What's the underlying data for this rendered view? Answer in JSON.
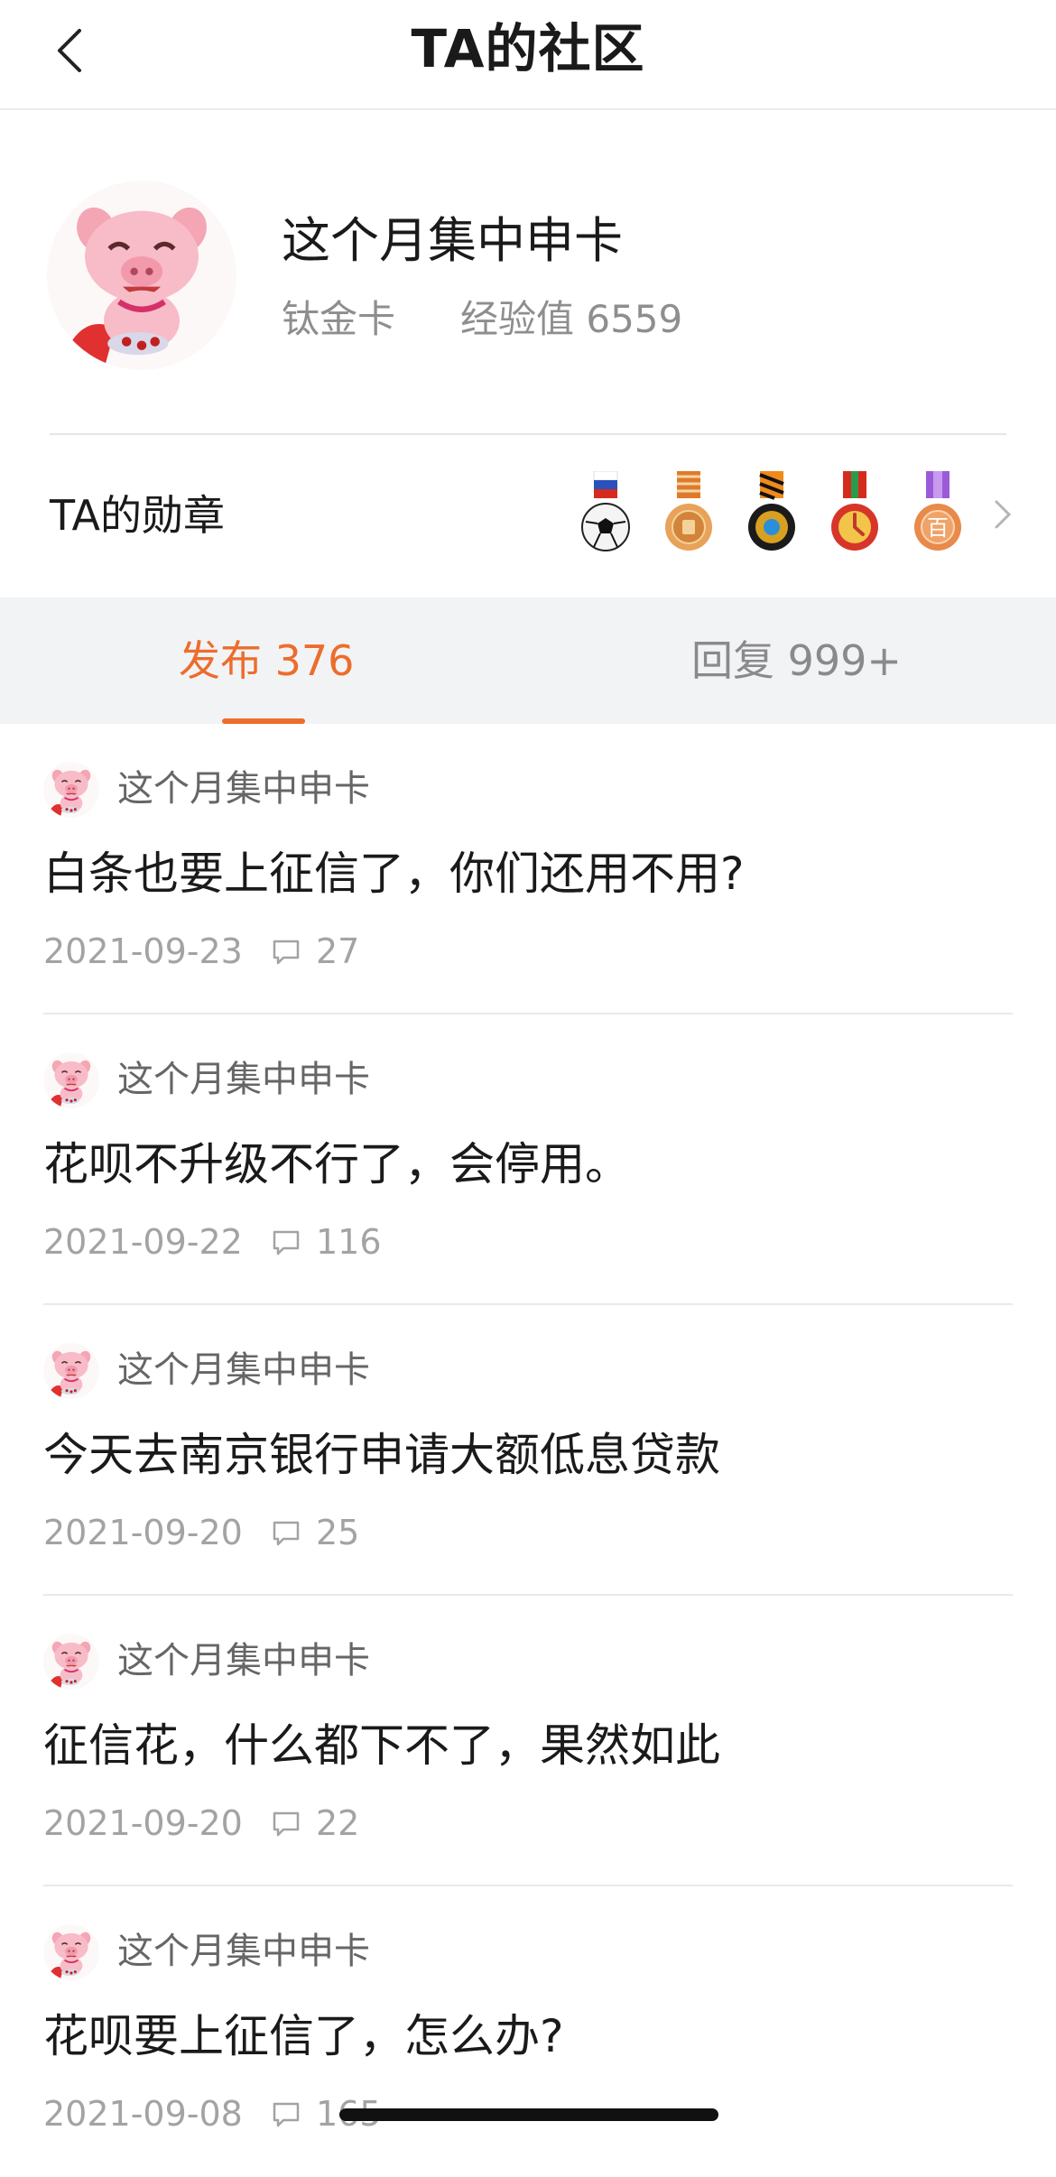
{
  "nav": {
    "title": "TA的社区"
  },
  "profile": {
    "name": "这个月集中申卡",
    "level": "钛金卡",
    "exp_label": "经验值 6559"
  },
  "badges": {
    "label": "TA的勋章",
    "items": [
      "football-medal-icon",
      "orange-ribbon-medal-icon",
      "striped-ribbon-medal-icon",
      "red-green-medal-icon",
      "bai-medal-icon"
    ],
    "bai_char": "百"
  },
  "tabs": [
    {
      "label": "发布 376",
      "active": true
    },
    {
      "label": "回复 999+",
      "active": false
    }
  ],
  "posts": [
    {
      "author": "这个月集中申卡",
      "title": "白条也要上征信了，你们还用不用?",
      "date": "2021-09-23",
      "comments": "27"
    },
    {
      "author": "这个月集中申卡",
      "title": "花呗不升级不行了，会停用。",
      "date": "2021-09-22",
      "comments": "116"
    },
    {
      "author": "这个月集中申卡",
      "title": "今天去南京银行申请大额低息贷款",
      "date": "2021-09-20",
      "comments": "25"
    },
    {
      "author": "这个月集中申卡",
      "title": "征信花，什么都下不了，果然如此",
      "date": "2021-09-20",
      "comments": "22"
    },
    {
      "author": "这个月集中申卡",
      "title": "花呗要上征信了，怎么办?",
      "date": "2021-09-08",
      "comments": "165"
    }
  ],
  "colors": {
    "accent": "#ec6d2c",
    "muted": "#a3a3a3",
    "tab_bg": "#f2f3f5"
  }
}
